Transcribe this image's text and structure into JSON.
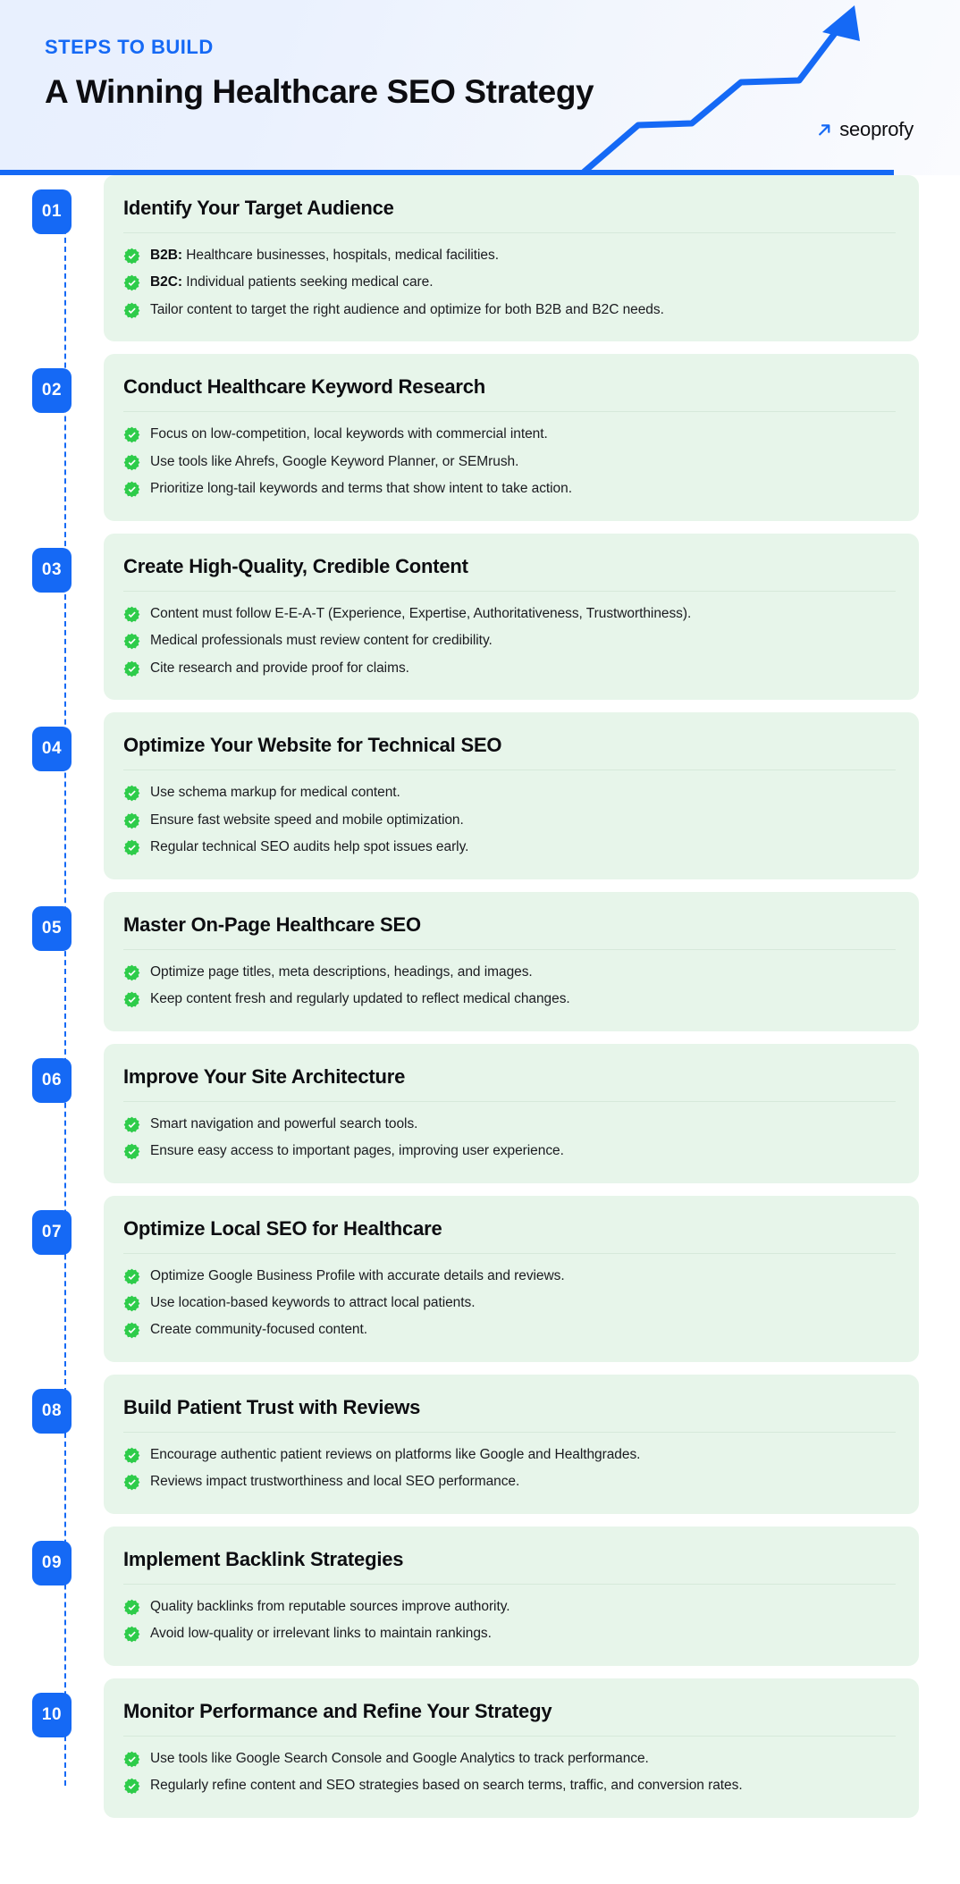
{
  "header": {
    "kicker": "STEPS TO BUILD",
    "headline": "A Winning Healthcare SEO Strategy",
    "brand_name": "seoprofy",
    "brand_icon": "diagonal-arrow-up-right-icon",
    "growth_icon": "rising-arrow-chart-icon",
    "accent_color": "#1569f5"
  },
  "theme": {
    "card_bg": "#e7f5ea",
    "badge_bg": "#1569f5",
    "check_color": "#2ecc4a",
    "title_color": "#0d0d11"
  },
  "steps": [
    {
      "number": "01",
      "title": "Identify Your Target Audience",
      "bullets": [
        {
          "lead": "B2B:",
          "text": " Healthcare businesses, hospitals, medical facilities."
        },
        {
          "lead": "B2C:",
          "text": " Individual patients seeking medical care."
        },
        {
          "lead": "",
          "text": "Tailor content to target the right audience and optimize for both B2B and B2C needs."
        }
      ]
    },
    {
      "number": "02",
      "title": "Conduct Healthcare Keyword Research",
      "bullets": [
        {
          "lead": "",
          "text": "Focus on low-competition, local keywords with commercial intent."
        },
        {
          "lead": "",
          "text": "Use tools like Ahrefs, Google Keyword Planner, or SEMrush."
        },
        {
          "lead": "",
          "text": "Prioritize long-tail keywords and terms that show intent to take action."
        }
      ]
    },
    {
      "number": "03",
      "title": "Create High-Quality, Credible Content",
      "bullets": [
        {
          "lead": "",
          "text": "Content must follow E-E-A-T (Experience, Expertise, Authoritativeness, Trustworthiness)."
        },
        {
          "lead": "",
          "text": "Medical professionals must review content for credibility."
        },
        {
          "lead": "",
          "text": "Cite research and provide proof for claims."
        }
      ]
    },
    {
      "number": "04",
      "title": "Optimize Your Website for Technical SEO",
      "bullets": [
        {
          "lead": "",
          "text": "Use schema markup for medical content."
        },
        {
          "lead": "",
          "text": "Ensure fast website speed and mobile optimization."
        },
        {
          "lead": "",
          "text": "Regular technical SEO audits help spot issues early."
        }
      ]
    },
    {
      "number": "05",
      "title": "Master On-Page Healthcare SEO",
      "bullets": [
        {
          "lead": "",
          "text": "Optimize page titles, meta descriptions, headings, and images."
        },
        {
          "lead": "",
          "text": "Keep content fresh and regularly updated to reflect medical changes."
        }
      ]
    },
    {
      "number": "06",
      "title": "Improve Your Site Architecture",
      "bullets": [
        {
          "lead": "",
          "text": "Smart navigation and powerful search tools."
        },
        {
          "lead": "",
          "text": "Ensure easy access to important pages, improving user experience."
        }
      ]
    },
    {
      "number": "07",
      "title": "Optimize Local SEO for Healthcare",
      "bullets": [
        {
          "lead": "",
          "text": "Optimize Google Business Profile with accurate details and reviews."
        },
        {
          "lead": "",
          "text": "Use location-based keywords to attract local patients."
        },
        {
          "lead": "",
          "text": "Create community-focused content."
        }
      ]
    },
    {
      "number": "08",
      "title": "Build Patient Trust with Reviews",
      "bullets": [
        {
          "lead": "",
          "text": "Encourage authentic patient reviews on platforms like Google and Healthgrades."
        },
        {
          "lead": "",
          "text": "Reviews impact trustworthiness and local SEO performance."
        }
      ]
    },
    {
      "number": "09",
      "title": "Implement Backlink Strategies",
      "bullets": [
        {
          "lead": "",
          "text": "Quality backlinks from reputable sources improve authority."
        },
        {
          "lead": "",
          "text": "Avoid low-quality or irrelevant links to maintain rankings."
        }
      ]
    },
    {
      "number": "10",
      "title": "Monitor Performance and Refine Your Strategy",
      "bullets": [
        {
          "lead": "",
          "text": "Use tools like Google Search Console and Google Analytics to track performance."
        },
        {
          "lead": "",
          "text": "Regularly refine content and SEO strategies based on search terms, traffic, and conversion rates."
        }
      ]
    }
  ]
}
